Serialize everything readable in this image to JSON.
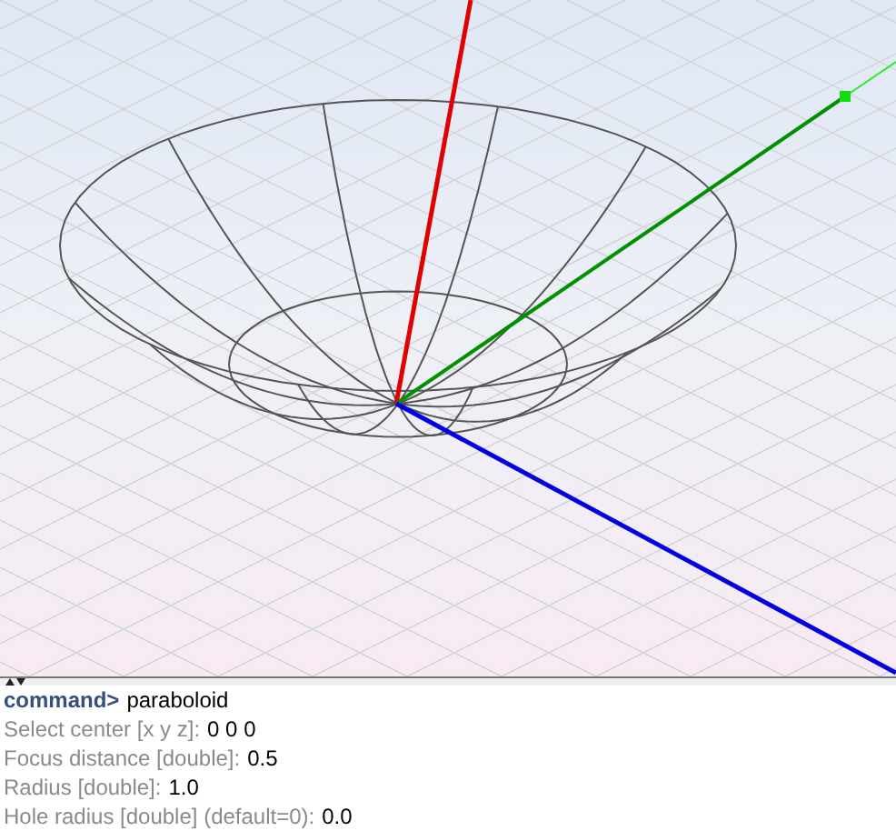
{
  "console": {
    "prompt": "command>",
    "command": "paraboloid",
    "lines": [
      {
        "prompt": "Select center [x y z]:",
        "value": "0 0 0"
      },
      {
        "prompt": "Focus distance [double]:",
        "value": "0.5"
      },
      {
        "prompt": "Radius [double]:",
        "value": "1.0"
      },
      {
        "prompt": "Hole radius [double] (default=0):",
        "value": "0.0"
      }
    ]
  }
}
